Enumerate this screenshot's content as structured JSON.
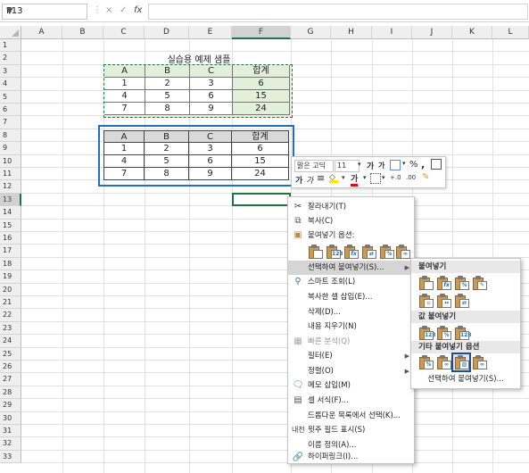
{
  "namebox": {
    "value": "F13"
  },
  "formula": {
    "fx_symbol": "fx",
    "cancel_symbol": "×",
    "enter_symbol": "✓",
    "value": ""
  },
  "columns": [
    "A",
    "B",
    "C",
    "D",
    "E",
    "F",
    "G",
    "H",
    "I",
    "J",
    "K",
    "L"
  ],
  "rows": [
    "1",
    "2",
    "3",
    "4",
    "5",
    "6",
    "7",
    "8",
    "9",
    "10",
    "11",
    "12",
    "13",
    "14",
    "15",
    "16",
    "17",
    "18",
    "19",
    "20",
    "21",
    "22",
    "23",
    "24",
    "25",
    "26",
    "27",
    "28",
    "29",
    "30",
    "31",
    "32",
    "33"
  ],
  "sheet": {
    "title": "실습용 예제 샘플",
    "table1": {
      "headers": [
        "A",
        "B",
        "C",
        "합계"
      ],
      "rows": [
        [
          "1",
          "2",
          "3",
          "6"
        ],
        [
          "4",
          "5",
          "6",
          "15"
        ],
        [
          "7",
          "8",
          "9",
          "24"
        ]
      ]
    },
    "table2": {
      "headers": [
        "A",
        "B",
        "C",
        "합계"
      ],
      "rows": [
        [
          "1",
          "2",
          "3",
          "6"
        ],
        [
          "4",
          "5",
          "6",
          "15"
        ],
        [
          "7",
          "8",
          "9",
          "24"
        ]
      ]
    }
  },
  "minitoolbar": {
    "font": "맑은 고딕",
    "size": "11",
    "bold": "가",
    "italic": "가",
    "align": "≡",
    "percent": "%",
    "comma": ",",
    "inc_dec1": "+.0",
    ".00": ".00",
    "font_grow": "가",
    "font_shrink": "가"
  },
  "context_menu": {
    "cut": "잘라내기(T)",
    "copy": "복사(C)",
    "paste_options": "붙여넣기 옵션:",
    "paste_special": "선택하여 붙여넣기(S)...",
    "smart_lookup": "스마트 조회(L)",
    "insert_copied": "복사한 셀 삽입(E)...",
    "delete": "삭제(D)...",
    "clear_contents": "내용 지우기(N)",
    "quick_analysis": "빠른 분석(Q)",
    "filter": "필터(E)",
    "sort": "정렬(O)",
    "insert_comment": "메모 삽입(M)",
    "format_cells": "셀 서식(F)...",
    "pick_dropdown": "드롭다운 목록에서 선택(K)...",
    "phonetic": "윗주 필드 표시(S)",
    "define_name": "이름 정의(A)...",
    "hyperlink": "하이퍼링크(I)..."
  },
  "submenu": {
    "paste": "붙여넣기",
    "paste_values": "값 붙여넣기",
    "other_paste": "기타 붙여넣기 옵션",
    "paste_special": "선택하여 붙여넣기(S)..."
  }
}
